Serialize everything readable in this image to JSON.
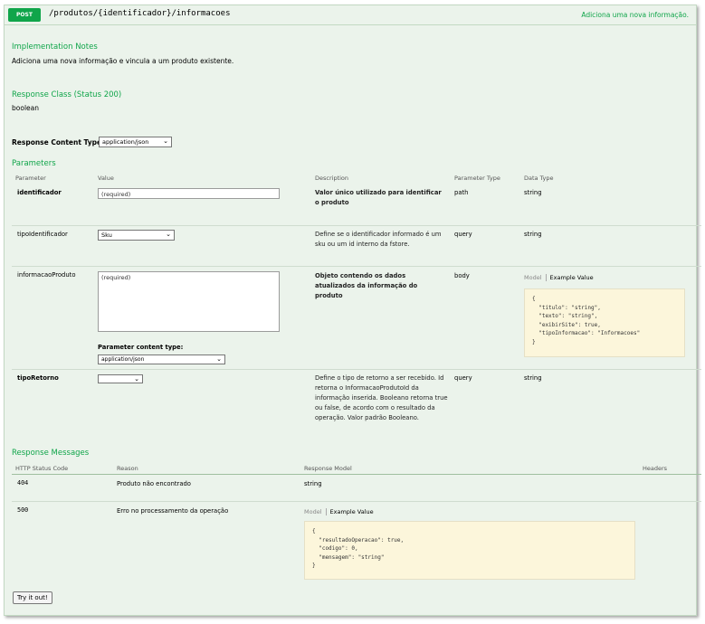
{
  "operation": {
    "method": "POST",
    "path": "/produtos/{identificador}/informacoes",
    "summary": "Adiciona uma nova informação."
  },
  "implementation_notes": {
    "heading": "Implementation Notes",
    "text": "Adiciona uma nova informação e vincula a um produto existente."
  },
  "response_class": {
    "heading": "Response Class (Status 200)",
    "type": "boolean"
  },
  "content_type": {
    "label": "Response Content Type",
    "value": "application/json"
  },
  "parameters": {
    "heading": "Parameters",
    "columns": [
      "Parameter",
      "Value",
      "Description",
      "Parameter Type",
      "Data Type"
    ],
    "rows": [
      {
        "name": "identificador",
        "placeholder": "(required)",
        "description": "Valor único utilizado para identificar o produto",
        "param_type": "path",
        "data_type": "string"
      },
      {
        "name": "tipoIdentificador",
        "value": "Sku",
        "description": "Define se o identificador informado é um sku ou um id interno da fstore.",
        "param_type": "query",
        "data_type": "string"
      },
      {
        "name": "informacaoProduto",
        "placeholder": "(required)",
        "content_type_label": "Parameter content type:",
        "content_type_value": "application/json",
        "description": "Objeto contendo os dados atualizados da informação do produto",
        "param_type": "body",
        "tab_model": "Model",
        "tab_example": "Example Value",
        "example": "{\n  \"titulo\": \"string\",\n  \"texto\": \"string\",\n  \"exibirSite\": true,\n  \"tipoInformacao\": \"Informacoes\"\n}"
      },
      {
        "name": "tipoRetorno",
        "value": "",
        "description": "Define o tipo de retorno a ser recebido. Id retorna o InformacaoProdutoId da informação inserida. Booleano retorna true ou false, de acordo com o resultado da operação. Valor padrão Booleano.",
        "param_type": "query",
        "data_type": "string"
      }
    ]
  },
  "response_messages": {
    "heading": "Response Messages",
    "columns": [
      "HTTP Status Code",
      "Reason",
      "Response Model",
      "Headers"
    ],
    "rows": [
      {
        "code": "404",
        "reason": "Produto não encontrado",
        "model": "string"
      },
      {
        "code": "500",
        "reason": "Erro no processamento da operação",
        "tab_model": "Model",
        "tab_example": "Example Value",
        "example": "{\n  \"resultadoOperacao\": true,\n  \"codigo\": 0,\n  \"mensagem\": \"string\"\n}"
      }
    ]
  },
  "try_button": "Try it out!",
  "colors": {
    "accent": "#10a54a",
    "panel": "#ebf3eb",
    "code_bg": "#fcf6db"
  }
}
